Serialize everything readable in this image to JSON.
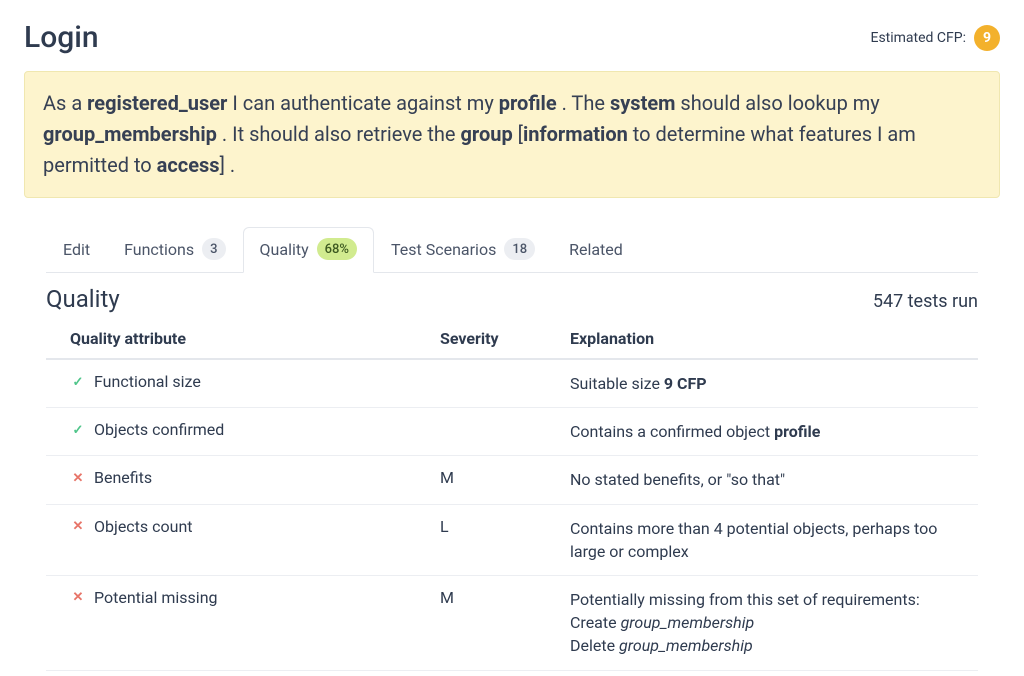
{
  "header": {
    "title": "Login",
    "cfp_label": "Estimated CFP:",
    "cfp_value": "9"
  },
  "story": {
    "parts": [
      {
        "text": "As a "
      },
      {
        "text": "registered_user",
        "bold": true
      },
      {
        "text": " I can authenticate against my "
      },
      {
        "text": "profile",
        "bold": true
      },
      {
        "text": " . The "
      },
      {
        "text": "system",
        "bold": true
      },
      {
        "text": " should also lookup my "
      },
      {
        "text": "group_membership",
        "bold": true
      },
      {
        "text": " . It should also retrieve the "
      },
      {
        "text": "group",
        "bold": true
      },
      {
        "text": " ["
      },
      {
        "text": "information",
        "bold": true
      },
      {
        "text": " to determine what features I am permitted to "
      },
      {
        "text": "access",
        "bold": true
      },
      {
        "text": "] ."
      }
    ]
  },
  "tabs": [
    {
      "label": "Edit",
      "badge": null,
      "active": false
    },
    {
      "label": "Functions",
      "badge": "3",
      "badge_style": "grey",
      "active": false
    },
    {
      "label": "Quality",
      "badge": "68%",
      "badge_style": "green",
      "active": true
    },
    {
      "label": "Test Scenarios",
      "badge": "18",
      "badge_style": "grey",
      "active": false
    },
    {
      "label": "Related",
      "badge": null,
      "active": false
    }
  ],
  "quality": {
    "section_title": "Quality",
    "tests_run": "547 tests run",
    "columns": {
      "attribute": "Quality attribute",
      "severity": "Severity",
      "explanation": "Explanation"
    },
    "rows": [
      {
        "icon": "check",
        "attribute": "Functional size",
        "severity": "",
        "explanation": [
          {
            "text": "Suitable size "
          },
          {
            "text": "9 CFP",
            "bold": true
          }
        ]
      },
      {
        "icon": "check",
        "attribute": "Objects confirmed",
        "severity": "",
        "explanation": [
          {
            "text": "Contains a confirmed object "
          },
          {
            "text": "profile",
            "bold": true
          }
        ]
      },
      {
        "icon": "cross",
        "attribute": "Benefits",
        "severity": "M",
        "explanation": [
          {
            "text": "No stated benefits, or \"so that\""
          }
        ]
      },
      {
        "icon": "cross",
        "attribute": "Objects count",
        "severity": "L",
        "explanation": [
          {
            "text": "Contains more than 4 potential objects, perhaps too large or complex"
          }
        ]
      },
      {
        "icon": "cross",
        "attribute": "Potential missing",
        "severity": "M",
        "explanation": [
          {
            "text": "Potentially missing from this set of requirements:"
          },
          {
            "br": true
          },
          {
            "text": "Create "
          },
          {
            "text": "group_membership",
            "italic": true
          },
          {
            "br": true
          },
          {
            "text": "Delete "
          },
          {
            "text": "group_membership",
            "italic": true
          }
        ]
      }
    ]
  }
}
